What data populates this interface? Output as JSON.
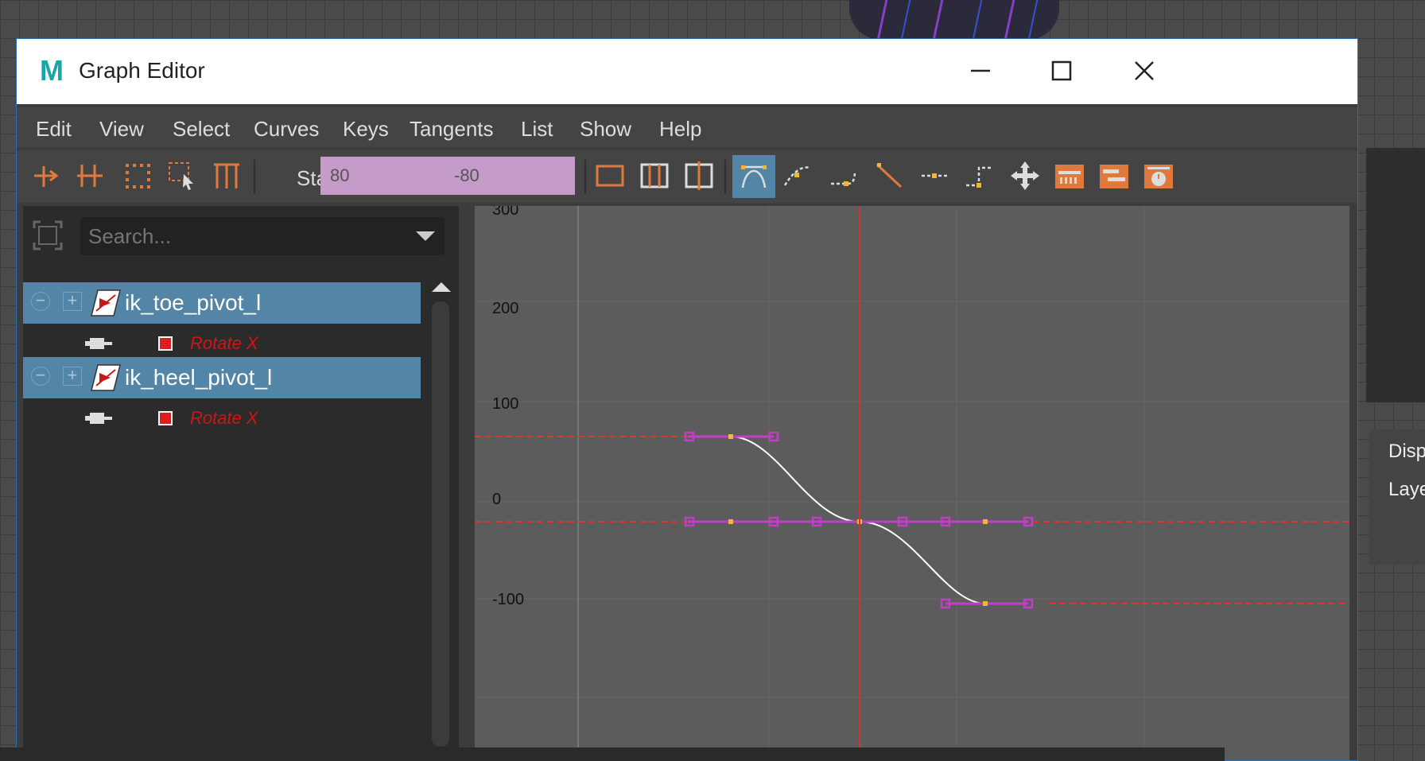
{
  "window": {
    "title": "Graph Editor",
    "logo_letter": "M"
  },
  "menu": [
    "Edit",
    "View",
    "Select",
    "Curves",
    "Keys",
    "Tangents",
    "List",
    "Show",
    "Help"
  ],
  "toolbar": {
    "stats_label": "Stats",
    "stats_value_1": "80",
    "stats_value_2": "-80",
    "highlight_color": "#5285a6",
    "stats_field_color": "#c59bc9"
  },
  "outliner": {
    "search_placeholder": "Search...",
    "nodes": [
      {
        "name": "ik_toe_pivot_l",
        "attribute": "Rotate X"
      },
      {
        "name": "ik_heel_pivot_l",
        "attribute": "Rotate X"
      }
    ]
  },
  "graph": {
    "y_labels": [
      "300",
      "200",
      "100",
      "0",
      "-100"
    ],
    "curve_color": "#ffffff",
    "infinity_line_color": "#e0342c",
    "tangent_color": "#c23ec9",
    "key_color": "#f2b632",
    "time_indicator_color": "#d0342c"
  },
  "right_panel": {
    "label_1": "Disp",
    "label_2": "Laye"
  }
}
